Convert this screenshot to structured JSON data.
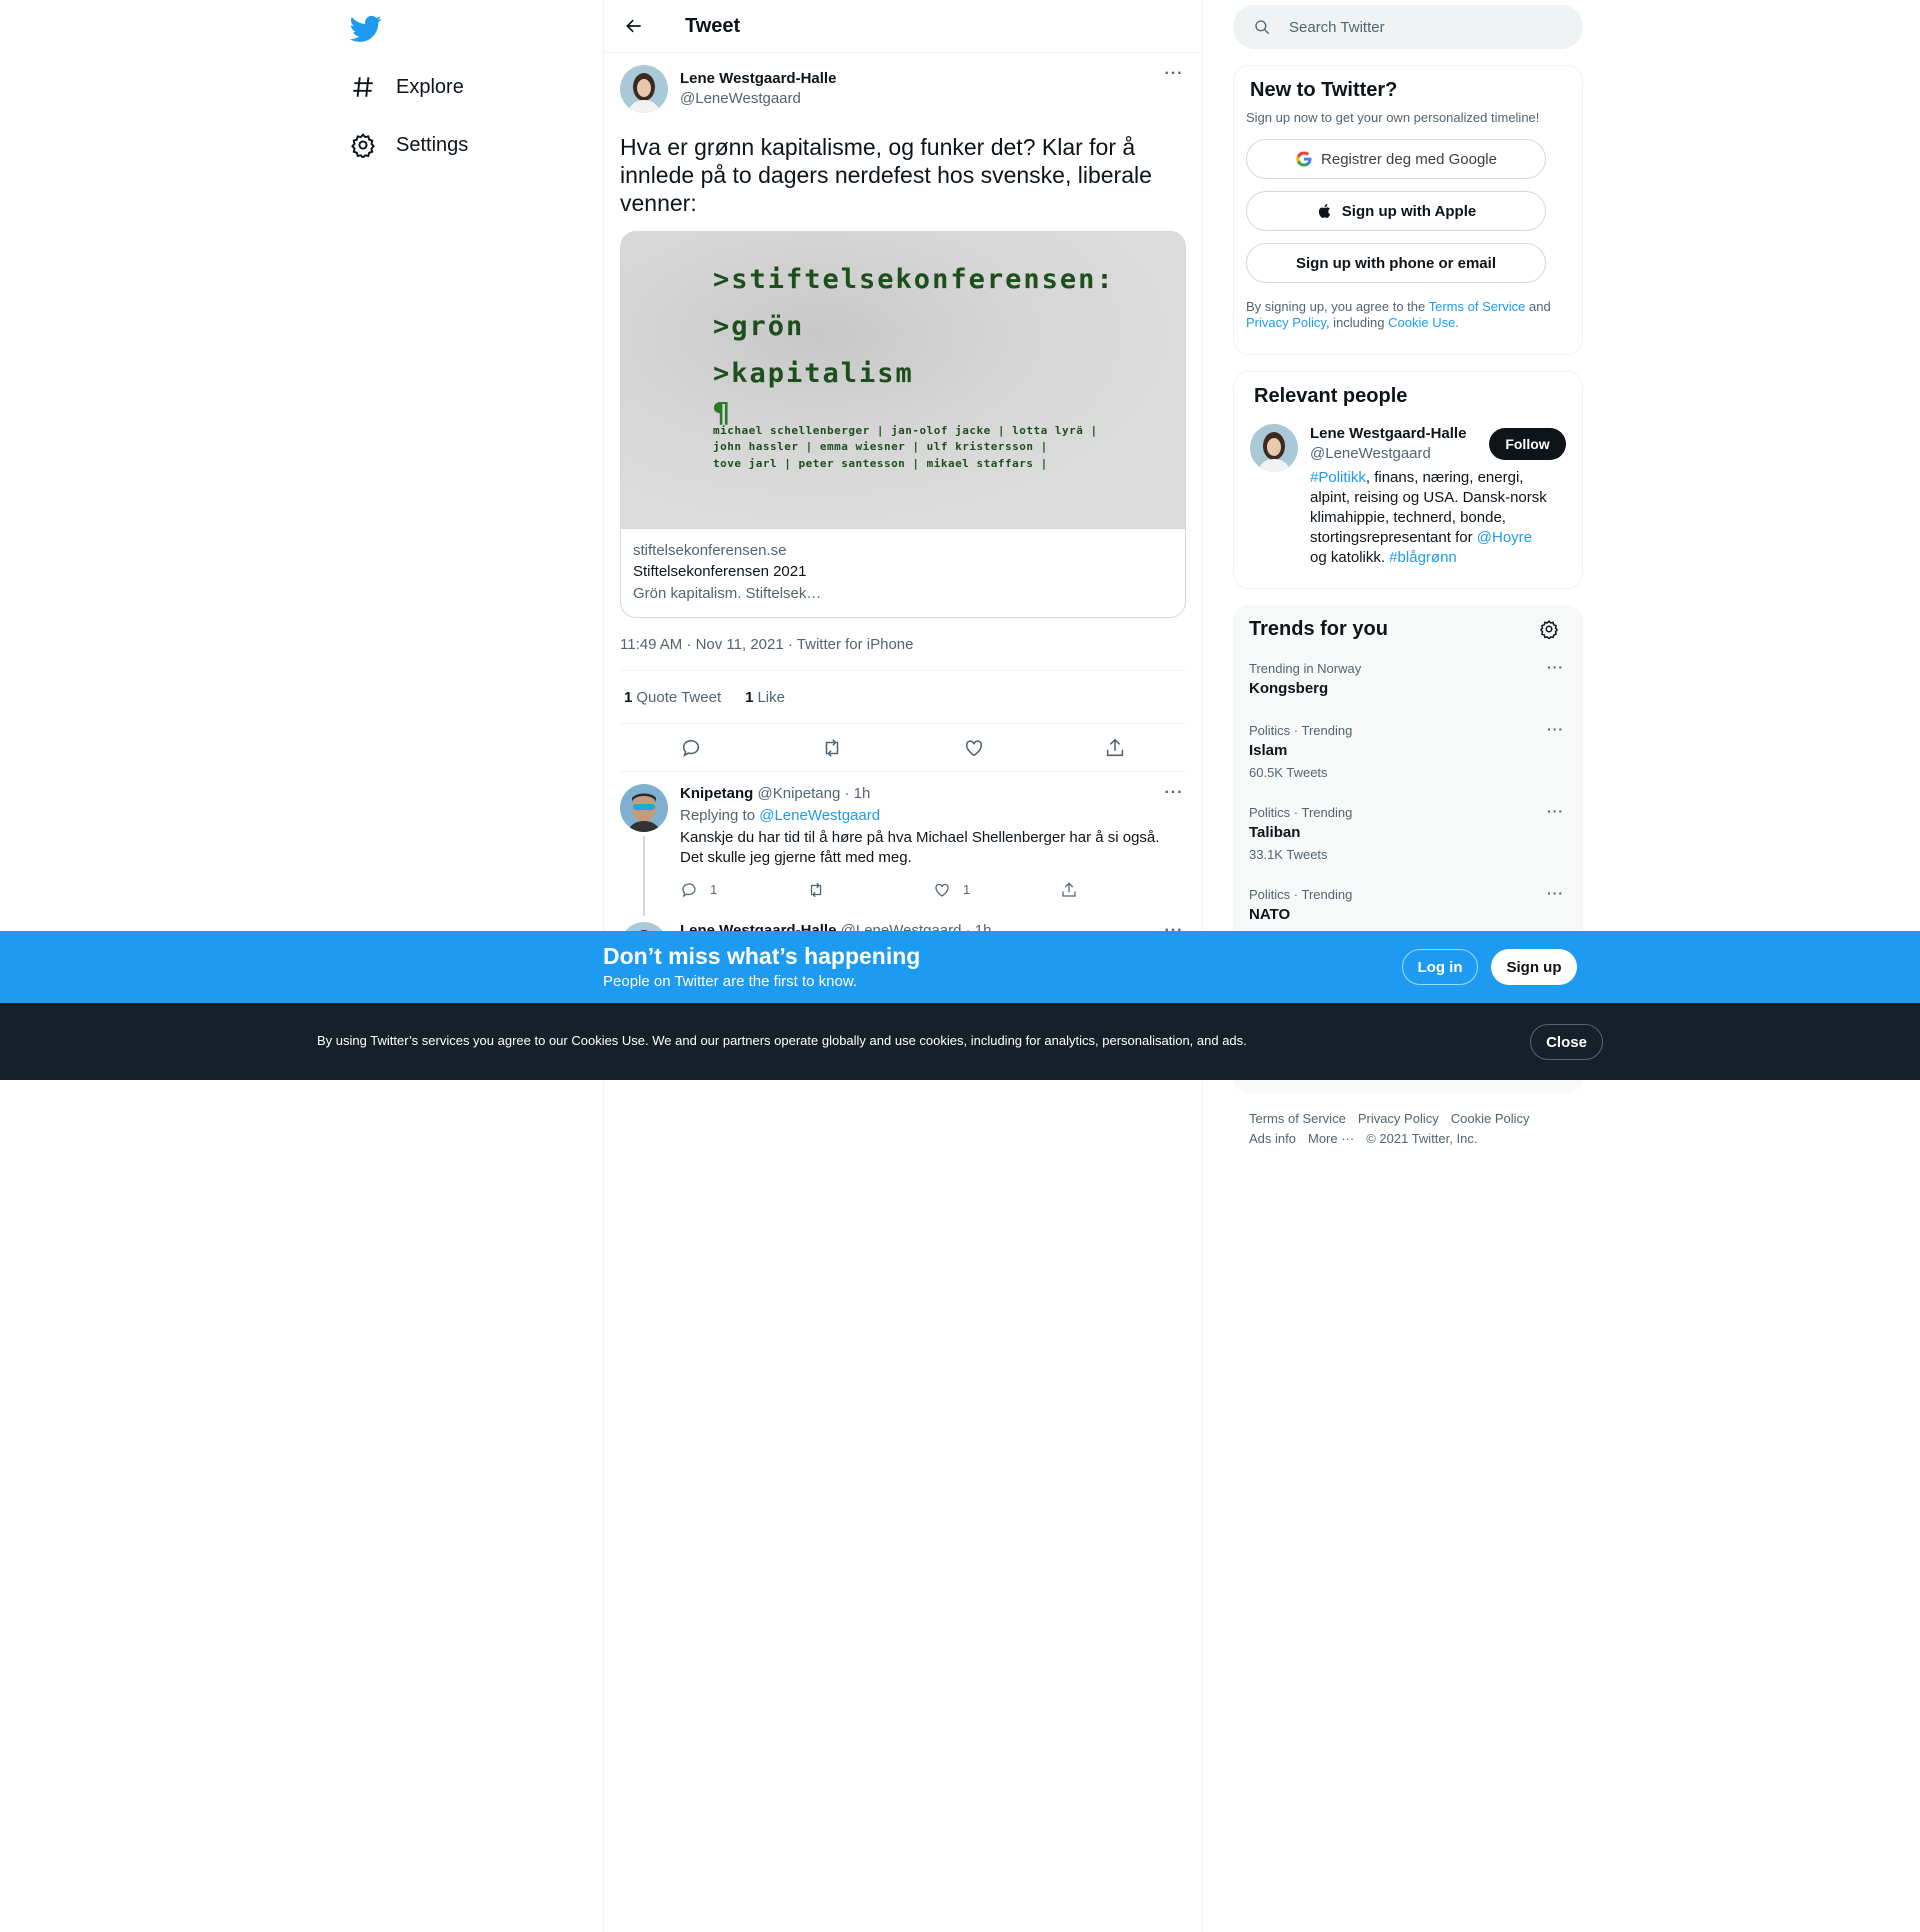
{
  "nav": {
    "items": [
      {
        "label": "Explore",
        "icon": "hashtag-icon"
      },
      {
        "label": "Settings",
        "icon": "gear-icon"
      }
    ]
  },
  "header": {
    "title": "Tweet"
  },
  "tweet": {
    "author_name": "Lene Westgaard-Halle",
    "author_handle": "@LeneWestgaard",
    "text": "Hva er grønn kapitalisme, og funker det? Klar for å innlede på to dagers nerdefest hos svenske, liberale venner:",
    "card": {
      "image_lines": [
        ">stiftelsekonferensen:",
        ">grön",
        ">kapitalism",
        "¶",
        "michael schellenberger | jan-olof jacke | lotta lyrä |",
        "john hassler | emma wiesner | ulf kristersson |",
        "tove jarl | peter santesson | mikael staffars |"
      ],
      "domain": "stiftelsekonferensen.se",
      "title": "Stiftelsekonferensen 2021",
      "description": "Grön kapitalism. Stiftelsek…"
    },
    "timestamp": "11:49 AM · Nov 11, 2021 · Twitter for iPhone",
    "stats": {
      "quote_count": "1",
      "quote_label": "Quote Tweet",
      "like_count": "1",
      "like_label": "Like"
    }
  },
  "reply": {
    "name": "Knipetang",
    "handle": "@Knipetang · 1h",
    "replying_prefix": "Replying to ",
    "replying_to": "@LeneWestgaard",
    "text_line1": "Kanskje du har tid til å høre på hva Michael Shellenberger har å si også.",
    "text_line2": "Det skulle jeg gjerne fått med meg.",
    "reply_count": "1",
    "like_count": "1"
  },
  "reply2": {
    "name": "Lene Westgaard-Halle",
    "handle": "@LeneWestgaard · 1h"
  },
  "search": {
    "placeholder": "Search Twitter"
  },
  "new_to_twitter": {
    "title": "New to Twitter?",
    "subtitle": "Sign up now to get your own personalized timeline!",
    "google": "Registrer deg med Google",
    "apple": "Sign up with Apple",
    "phone": "Sign up with phone or email",
    "legal_1": "By signing up, you agree to the ",
    "tos": "Terms of Service",
    "legal_2": " and ",
    "privacy": "Privacy Policy",
    "legal_3": ", including ",
    "cookie": "Cookie Use",
    "legal_4": "."
  },
  "relevant": {
    "title": "Relevant people",
    "name": "Lene Westgaard-Halle",
    "handle": "@LeneWestgaard",
    "follow": "Follow",
    "bio_tag1": "#Politikk",
    "bio_1": ", finans, næring, energi, alpint, reising og USA. Dansk-norsk klimahippie, technerd, bonde, stortingsrepresentant for ",
    "bio_mention": "@Hoyre",
    "bio_2": " og katolikk. ",
    "bio_tag2": "#blågrønn"
  },
  "trends": {
    "title": "Trends for you",
    "items": [
      {
        "context": "Trending in Norway",
        "name": "Kongsberg",
        "count": ""
      },
      {
        "context": "Politics · Trending",
        "name": "Islam",
        "count": "60.5K Tweets"
      },
      {
        "context": "Politics · Trending",
        "name": "Taliban",
        "count": "33.1K Tweets"
      },
      {
        "context": "Politics · Trending",
        "name": "NATO",
        "count": ""
      }
    ]
  },
  "footer": {
    "links": [
      "Terms of Service",
      "Privacy Policy",
      "Cookie Policy",
      "Ads info",
      "More ···",
      "© 2021 Twitter, Inc."
    ]
  },
  "banner": {
    "title": "Don’t miss what’s happening",
    "subtitle": "People on Twitter are the first to know.",
    "login": "Log in",
    "signup": "Sign up"
  },
  "cookie_bar": {
    "text": "By using Twitter’s services you agree to our Cookies Use. We and our partners operate globally and use cookies, including for analytics, personalisation, and ads.",
    "close": "Close"
  },
  "colors": {
    "accent": "#1d9bf0",
    "text": "#0f1419",
    "secondary": "#536471",
    "cookie_bg": "#15202b"
  }
}
